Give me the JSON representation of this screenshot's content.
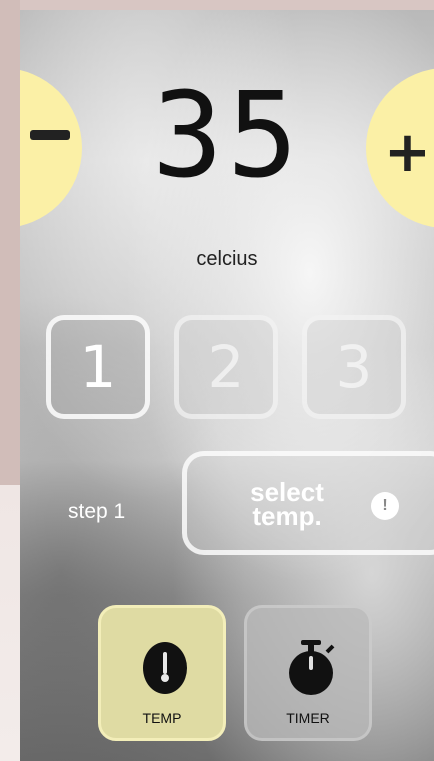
{
  "controls": {
    "decrease_symbol": "−",
    "increase_symbol": "+"
  },
  "display": {
    "temperature": "35",
    "unit": "celcius"
  },
  "steps": [
    {
      "label": "1",
      "active": true
    },
    {
      "label": "2",
      "active": false
    },
    {
      "label": "3",
      "active": false
    }
  ],
  "instruction": {
    "step_label": "step 1",
    "action_line1": "select",
    "action_line2": "temp.",
    "info_symbol": "!"
  },
  "tabs": [
    {
      "label": "TEMP",
      "icon": "thermometer-icon",
      "selected": true
    },
    {
      "label": "TIMER",
      "icon": "stopwatch-icon",
      "selected": false
    }
  ],
  "colors": {
    "accent_yellow": "#fbf0a6",
    "text_dark": "#111111"
  }
}
